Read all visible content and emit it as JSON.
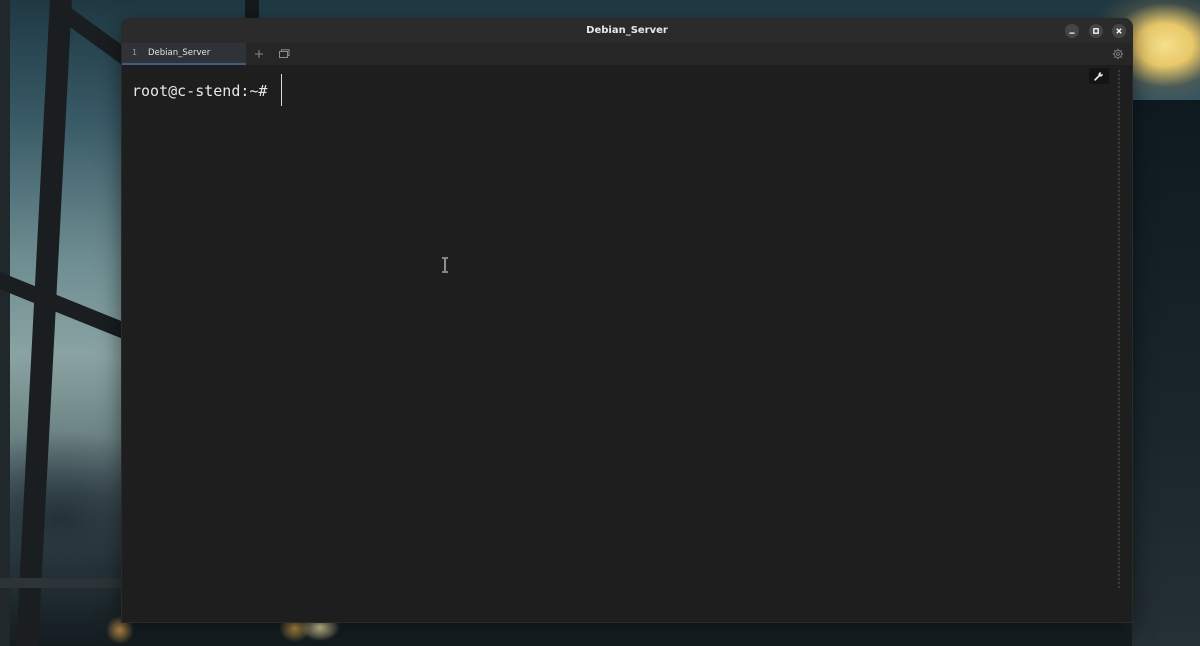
{
  "window": {
    "title": "Debian_Server",
    "controls": {
      "minimize_icon": "minimize-icon",
      "maximize_icon": "maximize-icon",
      "close_icon": "close-icon"
    }
  },
  "tabs": [
    {
      "number": "1",
      "label": "Debian_Server",
      "active": true
    }
  ],
  "tabbar_actions": {
    "new_tab_icon": "plus-icon",
    "overview_icon": "windows-icon",
    "settings_icon": "gear-icon"
  },
  "terminal": {
    "prompt": "root@c-stend:~#",
    "input": "",
    "toolbar_icon": "wrench-icon"
  },
  "colors": {
    "terminal_bg": "#1e1e1e",
    "titlebar_bg": "#2b2b2b",
    "tab_active_bg": "#2f3337",
    "tab_accent": "#3a5f86",
    "text": "#e6e6e6"
  }
}
